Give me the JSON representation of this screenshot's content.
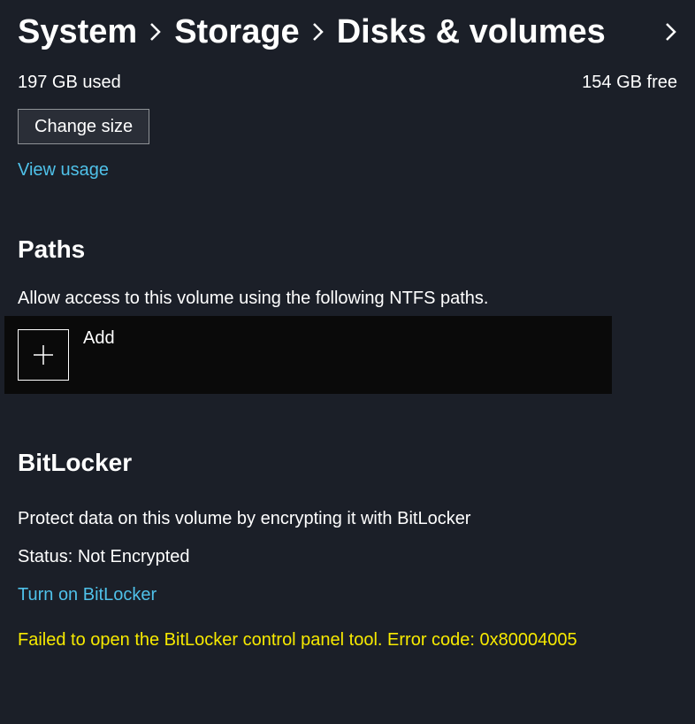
{
  "breadcrumb": {
    "items": [
      "System",
      "Storage",
      "Disks & volumes"
    ]
  },
  "usage": {
    "used": "197 GB used",
    "free": "154 GB free",
    "change_size_label": "Change size",
    "view_usage_label": "View usage"
  },
  "paths": {
    "title": "Paths",
    "description": "Allow access to this volume using the following NTFS paths.",
    "add_label": "Add"
  },
  "bitlocker": {
    "title": "BitLocker",
    "description": "Protect data on this volume by encrypting it with BitLocker",
    "status": "Status: Not Encrypted",
    "turn_on_label": "Turn on BitLocker",
    "error": "Failed to open the BitLocker control panel tool. Error code: 0x80004005"
  }
}
